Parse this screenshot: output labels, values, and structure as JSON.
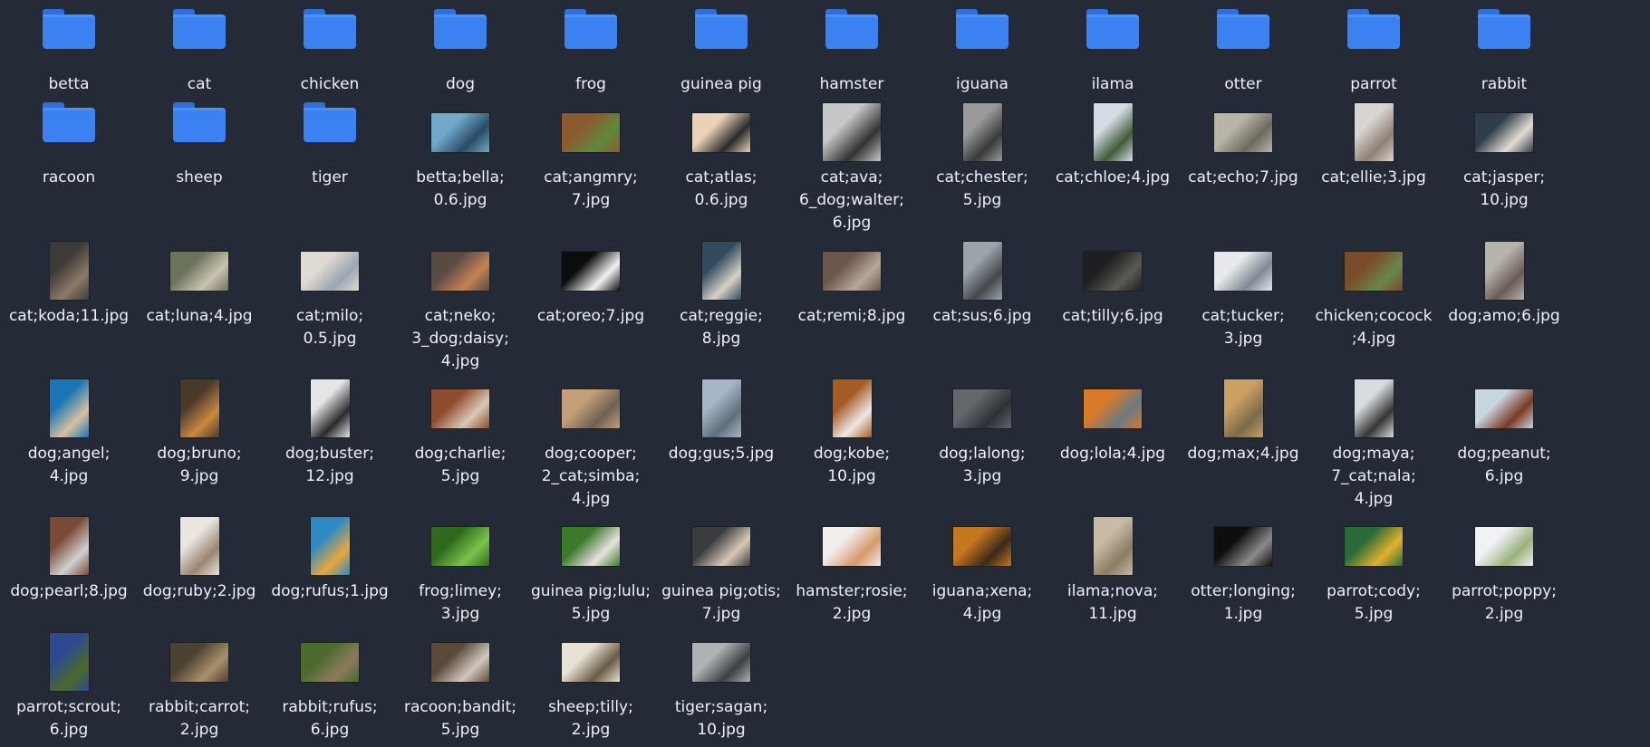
{
  "items": [
    {
      "type": "folder",
      "label": [
        "betta"
      ]
    },
    {
      "type": "folder",
      "label": [
        "cat"
      ]
    },
    {
      "type": "folder",
      "label": [
        "chicken"
      ]
    },
    {
      "type": "folder",
      "label": [
        "dog"
      ]
    },
    {
      "type": "folder",
      "label": [
        "frog"
      ]
    },
    {
      "type": "folder",
      "label": [
        "guinea pig"
      ]
    },
    {
      "type": "folder",
      "label": [
        "hamster"
      ]
    },
    {
      "type": "folder",
      "label": [
        "iguana"
      ]
    },
    {
      "type": "folder",
      "label": [
        "ilama"
      ]
    },
    {
      "type": "folder",
      "label": [
        "otter"
      ]
    },
    {
      "type": "folder",
      "label": [
        "parrot"
      ]
    },
    {
      "type": "folder",
      "label": [
        "rabbit"
      ]
    },
    {
      "type": "folder",
      "label": [
        "racoon"
      ]
    },
    {
      "type": "folder",
      "label": [
        "sheep"
      ]
    },
    {
      "type": "folder",
      "label": [
        "tiger"
      ]
    },
    {
      "type": "image",
      "label": [
        "betta;bella;",
        "0.6.jpg"
      ],
      "orient": "l",
      "colors": [
        "#6fa8c8",
        "#2a4b66"
      ]
    },
    {
      "type": "image",
      "label": [
        "cat;angmry;",
        "7.jpg"
      ],
      "orient": "l",
      "colors": [
        "#8c5a2e",
        "#5d8a3a"
      ]
    },
    {
      "type": "image",
      "label": [
        "cat;atlas;",
        "0.6.jpg"
      ],
      "orient": "l",
      "colors": [
        "#e9d2b8",
        "#2b2b2b"
      ]
    },
    {
      "type": "image",
      "label": [
        "cat;ava;",
        "6_dog;walter;",
        "6.jpg"
      ],
      "orient": "s",
      "colors": [
        "#c7c7c7",
        "#303330"
      ]
    },
    {
      "type": "image",
      "label": [
        "cat;chester;",
        "5.jpg"
      ],
      "orient": "p",
      "colors": [
        "#9a9a9a",
        "#3a3a3a"
      ]
    },
    {
      "type": "image",
      "label": [
        "cat;chloe;4.jpg"
      ],
      "orient": "p",
      "colors": [
        "#d7dde4",
        "#405c3a"
      ]
    },
    {
      "type": "image",
      "label": [
        "cat;echo;7.jpg"
      ],
      "orient": "l",
      "colors": [
        "#b9b5a6",
        "#6c6a60"
      ]
    },
    {
      "type": "image",
      "label": [
        "cat;ellie;3.jpg"
      ],
      "orient": "p",
      "colors": [
        "#d8d4d0",
        "#8e7f75"
      ]
    },
    {
      "type": "image",
      "label": [
        "cat;jasper;",
        "10.jpg"
      ],
      "orient": "l",
      "colors": [
        "#2f3d4a",
        "#e3dcd2"
      ]
    },
    {
      "type": "image",
      "label": [
        "cat;koda;11.jpg"
      ],
      "orient": "p",
      "colors": [
        "#3d3a37",
        "#8c7a68"
      ]
    },
    {
      "type": "image",
      "label": [
        "cat;luna;4.jpg"
      ],
      "orient": "l",
      "colors": [
        "#6c745c",
        "#c9c2b0"
      ]
    },
    {
      "type": "image",
      "label": [
        "cat;milo;",
        "0.5.jpg"
      ],
      "orient": "l",
      "colors": [
        "#e0dbd2",
        "#9aa6b3"
      ]
    },
    {
      "type": "image",
      "label": [
        "cat;neko;",
        "3_dog;daisy;",
        "4.jpg"
      ],
      "orient": "l",
      "colors": [
        "#5a4a44",
        "#c38452"
      ]
    },
    {
      "type": "image",
      "label": [
        "cat;oreo;7.jpg"
      ],
      "orient": "l",
      "colors": [
        "#0c0e0d",
        "#f2f2f2"
      ]
    },
    {
      "type": "image",
      "label": [
        "cat;reggie;",
        "8.jpg"
      ],
      "orient": "p",
      "colors": [
        "#2f4b5c",
        "#d6d0c6"
      ]
    },
    {
      "type": "image",
      "label": [
        "cat;remi;8.jpg"
      ],
      "orient": "l",
      "colors": [
        "#6a564c",
        "#b7a79a"
      ]
    },
    {
      "type": "image",
      "label": [
        "cat;sus;6.jpg"
      ],
      "orient": "p",
      "colors": [
        "#9aa4ab",
        "#44484c"
      ]
    },
    {
      "type": "image",
      "label": [
        "cat;tilly;6.jpg"
      ],
      "orient": "l",
      "colors": [
        "#1e1f22",
        "#5a5c52"
      ]
    },
    {
      "type": "image",
      "label": [
        "cat;tucker;",
        "3.jpg"
      ],
      "orient": "l",
      "colors": [
        "#e7e9ec",
        "#7f8a96"
      ]
    },
    {
      "type": "image",
      "label": [
        "chicken;cocock",
        ";4.jpg"
      ],
      "orient": "l",
      "colors": [
        "#7a4b2a",
        "#68874a"
      ]
    },
    {
      "type": "image",
      "label": [
        "dog;amo;6.jpg"
      ],
      "orient": "p",
      "colors": [
        "#b6b2ac",
        "#6a5b58"
      ]
    },
    {
      "type": "image",
      "label": [
        "dog;angel;",
        "4.jpg"
      ],
      "orient": "p",
      "colors": [
        "#1b76b6",
        "#d8c0a2"
      ]
    },
    {
      "type": "image",
      "label": [
        "dog;bruno;",
        "9.jpg"
      ],
      "orient": "p",
      "colors": [
        "#4b3a2a",
        "#c9893e"
      ]
    },
    {
      "type": "image",
      "label": [
        "dog;buster;",
        "12.jpg"
      ],
      "orient": "p",
      "colors": [
        "#e4e5e6",
        "#2a2a2c"
      ]
    },
    {
      "type": "image",
      "label": [
        "dog;charlie;",
        "5.jpg"
      ],
      "orient": "l",
      "colors": [
        "#8e4b2e",
        "#d7c8b5"
      ]
    },
    {
      "type": "image",
      "label": [
        "dog;cooper;",
        "2_cat;simba;",
        "4.jpg"
      ],
      "orient": "l",
      "colors": [
        "#c4a07a",
        "#6e6152"
      ]
    },
    {
      "type": "image",
      "label": [
        "dog;gus;5.jpg"
      ],
      "orient": "p",
      "colors": [
        "#a6b6c6",
        "#5f6f7e"
      ]
    },
    {
      "type": "image",
      "label": [
        "dog;kobe;",
        "10.jpg"
      ],
      "orient": "p",
      "colors": [
        "#a65b22",
        "#ece9e4"
      ]
    },
    {
      "type": "image",
      "label": [
        "dog;lalong;",
        "3.jpg"
      ],
      "orient": "l",
      "colors": [
        "#62676c",
        "#2d3034"
      ]
    },
    {
      "type": "image",
      "label": [
        "dog;lola;4.jpg"
      ],
      "orient": "l",
      "colors": [
        "#d9792a",
        "#6a7a82"
      ]
    },
    {
      "type": "image",
      "label": [
        "dog;max;4.jpg"
      ],
      "orient": "p",
      "colors": [
        "#caa063",
        "#7a6a4a"
      ]
    },
    {
      "type": "image",
      "label": [
        "dog;maya;",
        "7_cat;nala;",
        "4.jpg"
      ],
      "orient": "p",
      "colors": [
        "#d8dcde",
        "#343638"
      ]
    },
    {
      "type": "image",
      "label": [
        "dog;peanut;",
        "6.jpg"
      ],
      "orient": "l",
      "colors": [
        "#c8d6e0",
        "#7a3a22"
      ]
    },
    {
      "type": "image",
      "label": [
        "dog;pearl;8.jpg"
      ],
      "orient": "p",
      "colors": [
        "#7a4a36",
        "#cfd0d2"
      ]
    },
    {
      "type": "image",
      "label": [
        "dog;ruby;2.jpg"
      ],
      "orient": "p",
      "colors": [
        "#e9e6e2",
        "#9b8572"
      ]
    },
    {
      "type": "image",
      "label": [
        "dog;rufus;1.jpg"
      ],
      "orient": "p",
      "colors": [
        "#2d8ac6",
        "#e6a73a"
      ]
    },
    {
      "type": "image",
      "label": [
        "frog;limey;",
        "3.jpg"
      ],
      "orient": "l",
      "colors": [
        "#2f6a1e",
        "#7cc24a"
      ]
    },
    {
      "type": "image",
      "label": [
        "guinea pig;lulu;",
        "5.jpg"
      ],
      "orient": "l",
      "colors": [
        "#3c7a2a",
        "#e6e2de"
      ]
    },
    {
      "type": "image",
      "label": [
        "guinea pig;otis;",
        "7.jpg"
      ],
      "orient": "l",
      "colors": [
        "#3a3b3d",
        "#d8c8b8"
      ]
    },
    {
      "type": "image",
      "label": [
        "hamster;rosie;",
        "2.jpg"
      ],
      "orient": "l",
      "colors": [
        "#f1eeeb",
        "#d69a6a"
      ]
    },
    {
      "type": "image",
      "label": [
        "iguana;xena;",
        "4.jpg"
      ],
      "orient": "l",
      "colors": [
        "#c6781e",
        "#3a2a1a"
      ]
    },
    {
      "type": "image",
      "label": [
        "ilama;nova;",
        "11.jpg"
      ],
      "orient": "p",
      "colors": [
        "#c8bba6",
        "#8d7b64"
      ]
    },
    {
      "type": "image",
      "label": [
        "otter;longing;",
        "1.jpg"
      ],
      "orient": "l",
      "colors": [
        "#0e0e0e",
        "#8a8a88"
      ]
    },
    {
      "type": "image",
      "label": [
        "parrot;cody;",
        "5.jpg"
      ],
      "orient": "l",
      "colors": [
        "#2a6a3a",
        "#e2b12a"
      ]
    },
    {
      "type": "image",
      "label": [
        "parrot;poppy;",
        "2.jpg"
      ],
      "orient": "l",
      "colors": [
        "#f0f2f4",
        "#9ab27a"
      ]
    },
    {
      "type": "image",
      "label": [
        "parrot;scrout;",
        "6.jpg"
      ],
      "orient": "p",
      "colors": [
        "#2d4a8e",
        "#4b6a2a"
      ]
    },
    {
      "type": "image",
      "label": [
        "rabbit;carrot;",
        "2.jpg"
      ],
      "orient": "l",
      "colors": [
        "#4a4232",
        "#a98f6c"
      ]
    },
    {
      "type": "image",
      "label": [
        "rabbit;rufus;",
        "6.jpg"
      ],
      "orient": "l",
      "colors": [
        "#4a6a2e",
        "#8c7a5c"
      ]
    },
    {
      "type": "image",
      "label": [
        "racoon;bandit;",
        "5.jpg"
      ],
      "orient": "l",
      "colors": [
        "#5a4a3c",
        "#d0c8be"
      ]
    },
    {
      "type": "image",
      "label": [
        "sheep;tilly;",
        "2.jpg"
      ],
      "orient": "l",
      "colors": [
        "#e8e2d6",
        "#6a5a44"
      ]
    },
    {
      "type": "image",
      "label": [
        "tiger;sagan;",
        "10.jpg"
      ],
      "orient": "l",
      "colors": [
        "#aeb2b4",
        "#3c4044"
      ]
    }
  ]
}
